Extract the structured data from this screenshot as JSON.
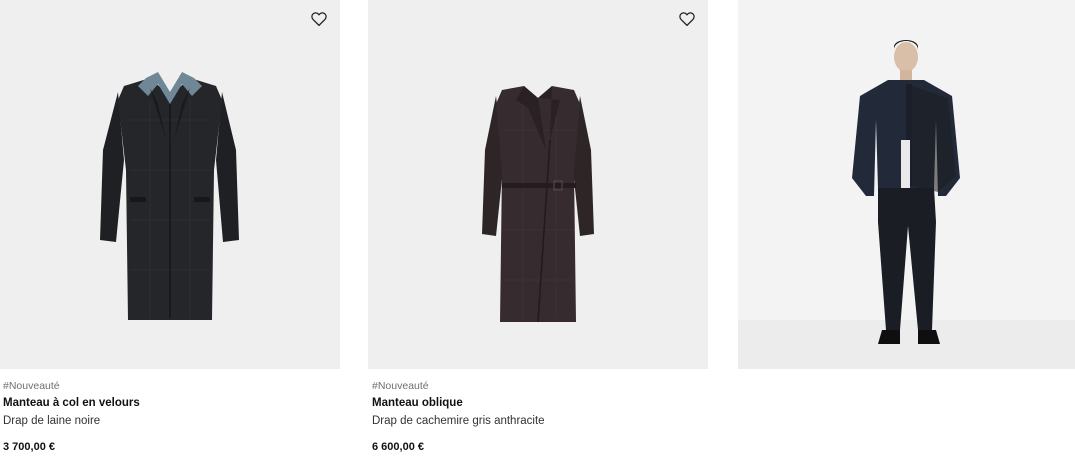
{
  "products": [
    {
      "tag": "#Nouveauté",
      "name": "Manteau à col en velours",
      "description": "Drap de laine noire",
      "price": "3 700,00 €",
      "wishlist_icon": "heart-outline-icon",
      "image": "black-wool-coat-with-velvet-collar"
    },
    {
      "tag": "#Nouveauté",
      "name": "Manteau oblique",
      "description": "Drap de cachemire gris anthracite",
      "price": "6 600,00 €",
      "wishlist_icon": "heart-outline-icon",
      "image": "anthracite-belted-double-breasted-coat"
    },
    {
      "image": "model-in-navy-bomber-jacket-and-black-trousers"
    }
  ],
  "colors": {
    "tile_background": "#efefef",
    "text_primary": "#111111",
    "text_muted": "#6f6f6f"
  }
}
